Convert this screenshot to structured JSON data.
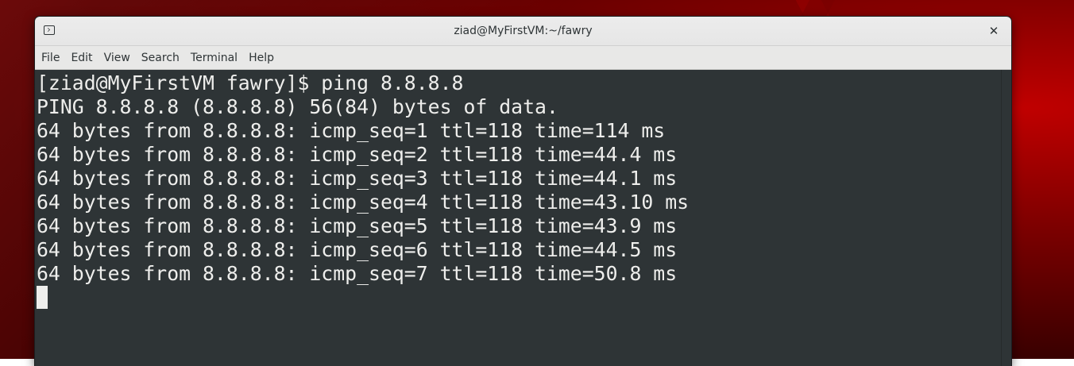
{
  "window": {
    "title": "ziad@MyFirstVM:~/fawry",
    "close_label": "✕"
  },
  "menu": {
    "items": [
      "File",
      "Edit",
      "View",
      "Search",
      "Terminal",
      "Help"
    ]
  },
  "terminal": {
    "lines": [
      "[ziad@MyFirstVM fawry]$ ping 8.8.8.8",
      "PING 8.8.8.8 (8.8.8.8) 56(84) bytes of data.",
      "64 bytes from 8.8.8.8: icmp_seq=1 ttl=118 time=114 ms",
      "64 bytes from 8.8.8.8: icmp_seq=2 ttl=118 time=44.4 ms",
      "64 bytes from 8.8.8.8: icmp_seq=3 ttl=118 time=44.1 ms",
      "64 bytes from 8.8.8.8: icmp_seq=4 ttl=118 time=43.10 ms",
      "64 bytes from 8.8.8.8: icmp_seq=5 ttl=118 time=43.9 ms",
      "64 bytes from 8.8.8.8: icmp_seq=6 ttl=118 time=44.5 ms",
      "64 bytes from 8.8.8.8: icmp_seq=7 ttl=118 time=50.8 ms"
    ]
  },
  "icons": {
    "app_icon": "terminal-icon",
    "close": "close-icon"
  },
  "colors": {
    "terminal_bg": "#2e3436",
    "terminal_fg": "#eeeeec",
    "titlebar_bg": "#ececec",
    "desktop_accent": "#c00000"
  }
}
